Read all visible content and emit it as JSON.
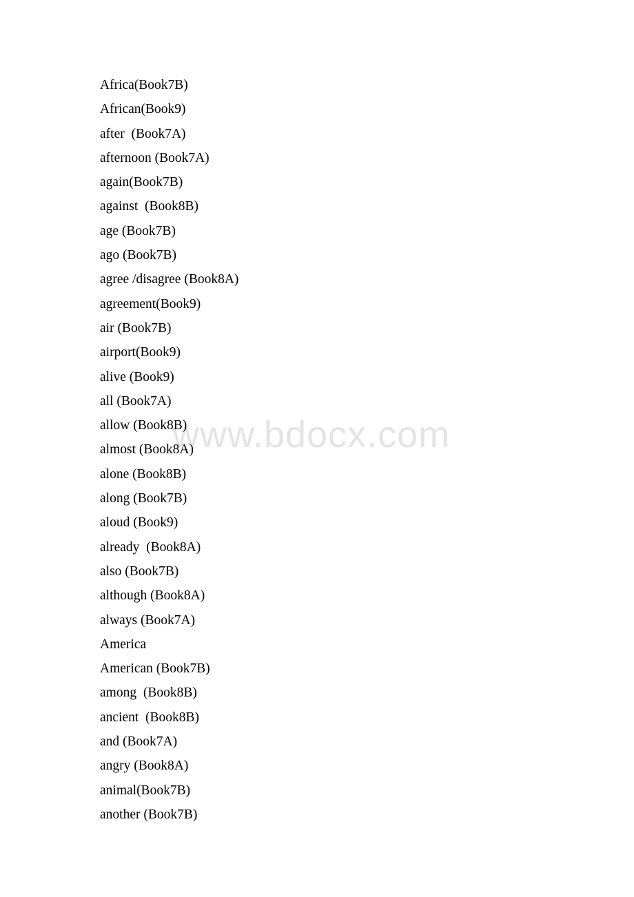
{
  "document": {
    "type": "scanned-word-list",
    "background_color": "#ffffff",
    "text_color": "#000000"
  },
  "watermark": {
    "text": "www.bdocx.com",
    "color": "#e4e4e4"
  },
  "word_list": {
    "entries": [
      {
        "text": "Africa(Book7B)"
      },
      {
        "text": "African(Book9)"
      },
      {
        "text": "after  (Book7A)"
      },
      {
        "text": "afternoon (Book7A)"
      },
      {
        "text": "again(Book7B)"
      },
      {
        "text": "against  (Book8B)"
      },
      {
        "text": "age (Book7B)"
      },
      {
        "text": "ago (Book7B)"
      },
      {
        "text": "agree /disagree (Book8A)"
      },
      {
        "text": "agreement(Book9)"
      },
      {
        "text": "air (Book7B)"
      },
      {
        "text": "airport(Book9)"
      },
      {
        "text": "alive (Book9)"
      },
      {
        "text": "all (Book7A)"
      },
      {
        "text": "allow (Book8B)"
      },
      {
        "text": "almost (Book8A)"
      },
      {
        "text": "alone (Book8B)"
      },
      {
        "text": "along (Book7B)"
      },
      {
        "text": "aloud (Book9)"
      },
      {
        "text": "already  (Book8A)"
      },
      {
        "text": "also (Book7B)"
      },
      {
        "text": "although (Book8A)"
      },
      {
        "text": "always (Book7A)"
      },
      {
        "text": "America"
      },
      {
        "text": "American (Book7B)"
      },
      {
        "text": "among  (Book8B)"
      },
      {
        "text": "ancient  (Book8B)"
      },
      {
        "text": "and (Book7A)"
      },
      {
        "text": "angry (Book8A)"
      },
      {
        "text": "animal(Book7B)"
      },
      {
        "text": "another (Book7B)"
      }
    ]
  }
}
